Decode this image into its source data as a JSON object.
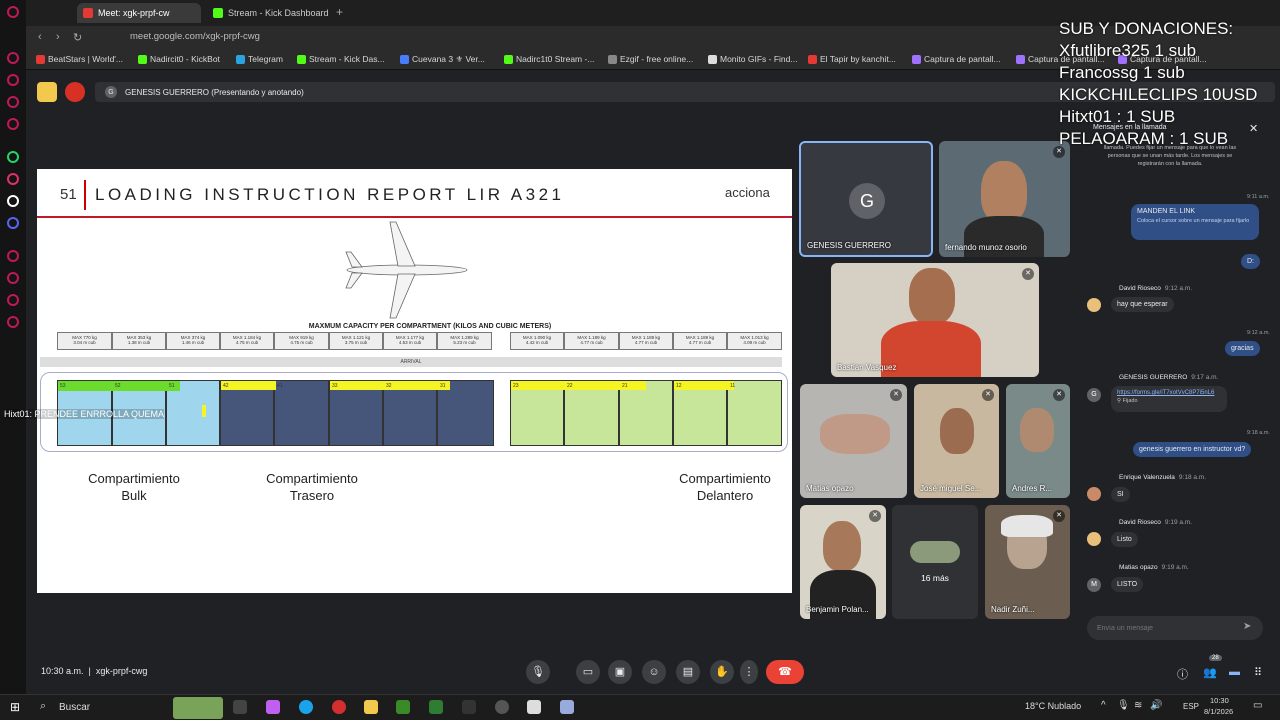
{
  "browser": {
    "tabs": [
      {
        "label": "Meet: xgk-prpf-cw"
      },
      {
        "label": "Stream - Kick Dashboard"
      }
    ],
    "url": "meet.google.com/xgk-prpf-cwg",
    "bookmarks": [
      "BeatStars | World'...",
      "Nadircit0 - KickBot",
      "Telegram",
      "Stream - Kick Das...",
      "Cuevana 3 ⚜ Ver...",
      "Nadirc1t0 Stream -...",
      "Ezgif - free online...",
      "Monito GIFs - Find...",
      "El Tapir by kanchit...",
      "Captura de pantall...",
      "Captura de pantall...",
      "Captura de pantall..."
    ]
  },
  "meet": {
    "presenter_label": "GENESIS GUERRERO (Presentando y anotando)",
    "presenter_initial": "G",
    "meeting_time": "10:30 a.m.",
    "meeting_code": "xgk-prpf-cwg",
    "participants_count": "28",
    "more_count": "16 más"
  },
  "stream_overlay": {
    "lines": [
      "SUB Y DONACIONES:",
      "Xfutlibre325 1 sub",
      "Francossg 1 sub",
      "KICKCHILECLIPS 10USD",
      "Hitxt01 : 1 SUB",
      "PELAOARAM : 1 SUB"
    ]
  },
  "slide": {
    "number": "51",
    "title": "LOADING INSTRUCTION REPORT LIR A321",
    "logo": "acciona",
    "capacity_title": "MAXMUM CAPACITY PER COMPARTMENT (KILOS AND CUBIC METERS)",
    "arrival_label": "ARRIVAL",
    "capacity_cells": [
      "MAX 770 kg\n3.04 m cub",
      "MAX 353 kg\n1.38 m cub",
      "MAX 374 kg\n1.46 m cub",
      "MAX 1.184 kg\n4.75 m cub",
      "MAX 919 kg\n4.75 m cub",
      "MAX 1.121 kg\n3.75 m cub",
      "MAX 1.177 kg\n4.53 m cub",
      "MAX 1.289 kg\n5.23 m cub",
      "MAX 1.090 kg\n4.42 m cub",
      "MAX 1.189 kg\n4.77 m cub",
      "MAX 1.189 kg\n4.77 m cub",
      "MAX 1.189 kg\n4.77 m cub",
      "MAX 1.013 kg\n4.09 m cub"
    ],
    "bay_numbers_rear": [
      "53",
      "52",
      "51",
      "42",
      "41",
      "33",
      "32",
      "31"
    ],
    "bay_numbers_front": [
      "23",
      "22",
      "21",
      "12",
      "11"
    ],
    "annotation_overlay": "Hixt01: PRENDEE ENRROLLA QUEMA",
    "labels": {
      "bulk_1": "Compartimiento",
      "bulk_2": "Bulk",
      "rear_1": "Compartimiento",
      "rear_2": "Trasero",
      "front_1": "Compartimiento",
      "front_2": "Delantero"
    }
  },
  "tiles": [
    {
      "name": "GENESIS GUERRERO",
      "initial": "G"
    },
    {
      "name": "fernando munoz osorio"
    },
    {
      "name": "Bastian Vasquez"
    },
    {
      "name": "Matias opazo"
    },
    {
      "name": "José miguel Se..."
    },
    {
      "name": "Andres R..."
    },
    {
      "name": "Benjamin Polan..."
    },
    {
      "name": "Nadir Zuñi..."
    }
  ],
  "chat": {
    "header": "Mensajes en la llamada",
    "info": "llamada. Puedes fijar un mensaje para que lo vean las personas que se unan más tarde. Los mensajes se registrarán con la llamada.",
    "messages": [
      {
        "time": "9:11 a.m.",
        "text": "MANDEN EL LINK",
        "sub": "Coloca el cursor sobre un mensaje para fijarlo"
      },
      {
        "text": "D:"
      },
      {
        "author": "David Rioseco",
        "time": "9:12 a.m.",
        "text": "hay que esperar"
      },
      {
        "time": "9:12 a.m.",
        "text": "gracias"
      },
      {
        "author": "GENESIS GUERRERO",
        "time": "9:17 a.m.",
        "text": "https://forms.gle/iT7xotVvC8P7i5nL6",
        "pin": "Fijado"
      },
      {
        "time": "9:18 a.m.",
        "text": "genesis guerrero en instructor vd?"
      },
      {
        "author": "Enrique Valenzuela",
        "time": "9:18 a.m.",
        "text": "SI"
      },
      {
        "author": "David Rioseco",
        "time": "9:19 a.m.",
        "text": "Listo"
      },
      {
        "author": "Matias opazo",
        "time": "9:19 a.m.",
        "text": "LISTO"
      }
    ],
    "input_placeholder": "Envía un mensaje"
  },
  "taskbar": {
    "search": "Buscar",
    "weather": "18°C  Nublado",
    "lang": "ESP",
    "time": "10:30",
    "date": "8/1/2026"
  }
}
